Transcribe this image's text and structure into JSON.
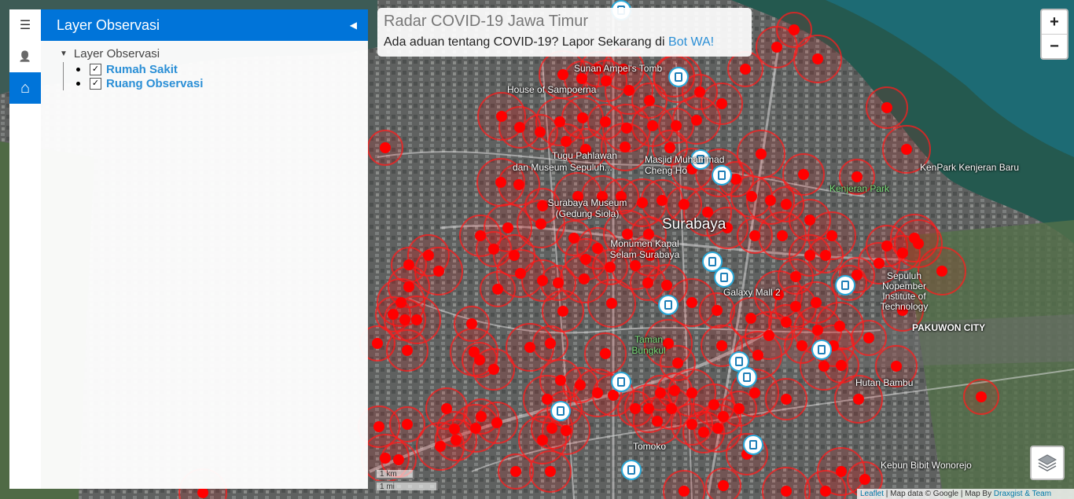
{
  "sidebar": {
    "tabs": [
      {
        "icon": "menu-icon",
        "glyph": "☰"
      },
      {
        "icon": "user-icon",
        "glyph": "👤"
      },
      {
        "icon": "home-icon",
        "glyph": "⌂"
      }
    ],
    "panel_title": "Layer Observasi",
    "collapse_glyph": "◀",
    "tree": {
      "root": "Layer Observasi",
      "items": [
        {
          "label": "Rumah Sakit",
          "checked": true
        },
        {
          "label": "Ruang Observasi",
          "checked": true
        }
      ]
    }
  },
  "info": {
    "title": "Radar COVID-19 Jawa Timur",
    "text": "Ada aduan tentang COVID-19? Lapor Sekarang di ",
    "link": "Bot WA!"
  },
  "zoom": {
    "in": "+",
    "out": "−"
  },
  "scale": {
    "km": "1 km",
    "mi": "1 mi"
  },
  "attribution": {
    "leaflet": "Leaflet",
    "sep1": " | Map data © Google | Map By ",
    "author": "Draxgist & Team"
  },
  "map_labels": {
    "surabaya": "Surabaya",
    "sunan": "Sunan Ampel's Tomb",
    "sampoerna": "House of Sampoerna",
    "tugu": "Tugu Pahlawan",
    "museum_sepuluh": "dan Museum Sepuluh...",
    "masjid": "Masjid Muhammad Cheng Ho",
    "museum": "Surabaya Museum (Gedung Siola)",
    "monumen": "Monumen Kapal Selam Surabaya",
    "kenpark": "KenPark Kenjeran Baru",
    "kenjeran": "Kenjeran Park",
    "galaxy": "Galaxy Mall 2",
    "sepuluh": "Sepuluh Nopember Institute of Technology",
    "pakuwon": "PAKUWON CITY",
    "taman": "Taman Bungkul",
    "hutan": "Hutan Bambu",
    "tomoko": "Tomoko",
    "kebun": "Kebun Bibit Wonorejo"
  },
  "colors": {
    "accent": "#0074d9",
    "marker": "#ff0000",
    "link": "#2b8fd6"
  }
}
